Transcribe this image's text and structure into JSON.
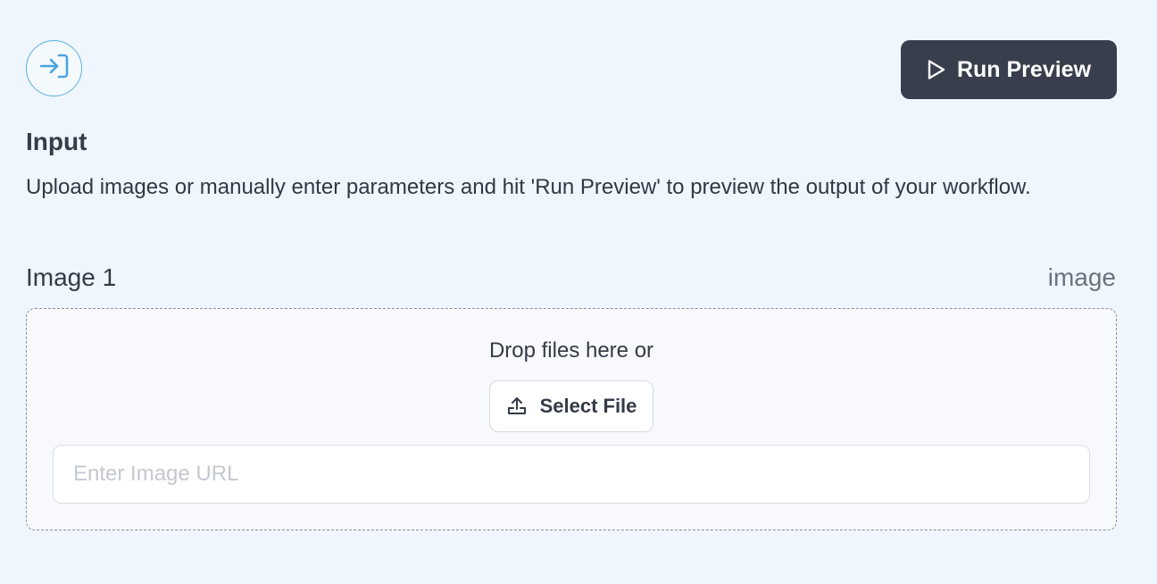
{
  "header": {
    "badge_icon": "input-arrow-icon",
    "run_button": {
      "label": "Run Preview",
      "icon": "play-icon"
    }
  },
  "section": {
    "title": "Input",
    "description": "Upload images or manually enter parameters and hit 'Run Preview' to preview the output of your workflow."
  },
  "field": {
    "label": "Image 1",
    "type": "image",
    "dropzone": {
      "prompt": "Drop files here or",
      "select_button": {
        "label": "Select File",
        "icon": "upload-icon"
      },
      "url_input": {
        "value": "",
        "placeholder": "Enter Image URL"
      }
    }
  },
  "colors": {
    "background": "#eff6fd",
    "accent": "#5aaee0",
    "primary_button": "#383e4b"
  }
}
